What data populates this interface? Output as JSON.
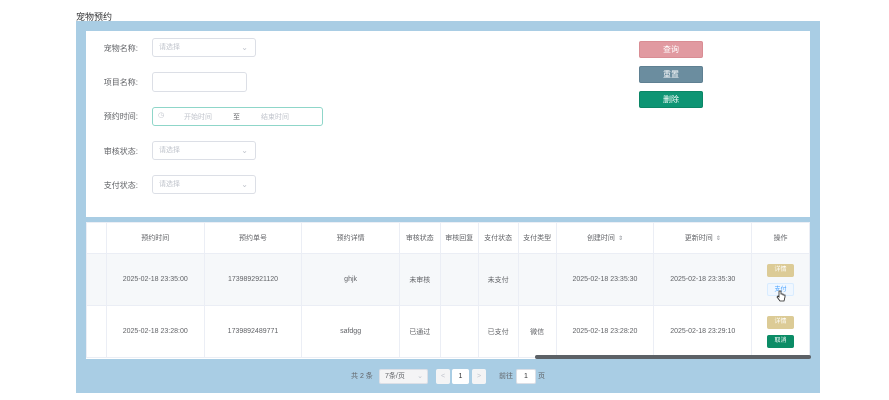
{
  "page": {
    "title": "宠物预约"
  },
  "form": {
    "pet_name_label": "宠物名称:",
    "pet_name_placeholder": "请选择",
    "project_name_label": "项目名称:",
    "project_name_value": "",
    "appointment_time_label": "预约时间:",
    "start_placeholder": "开始时间",
    "range_separator": "至",
    "end_placeholder": "结束时间",
    "review_status_label": "审核状态:",
    "review_status_placeholder": "请选择",
    "pay_status_label": "支付状态:",
    "pay_status_placeholder": "请选择"
  },
  "actions": {
    "query": "查询",
    "reset": "重置",
    "delete": "删除"
  },
  "table": {
    "headers": [
      "预约时间",
      "预约单号",
      "预约详情",
      "审核状态",
      "审核回复",
      "支付状态",
      "支付类型",
      "创建时间",
      "更新时间",
      "操作"
    ],
    "rows": [
      {
        "time": "2025-02-18 23:35:00",
        "order_no": "1739892921120",
        "detail": "ghjk",
        "review_status": "未审核",
        "review_reply": "",
        "pay_status": "未支付",
        "pay_type": "",
        "created": "2025-02-18 23:35:30",
        "updated": "2025-02-18 23:35:30",
        "op_detail": "详情",
        "op_second": "支付"
      },
      {
        "time": "2025-02-18 23:28:00",
        "order_no": "1739892489771",
        "detail": "safdgg",
        "review_status": "已通过",
        "review_reply": "",
        "pay_status": "已支付",
        "pay_type": "微信",
        "created": "2025-02-18 23:28:20",
        "updated": "2025-02-18 23:29:10",
        "op_detail": "详情",
        "op_second": "取消"
      }
    ]
  },
  "pagination": {
    "total": "共 2 条",
    "page_size": "7条/页",
    "prev": "<",
    "current": "1",
    "next": ">",
    "goto_label": "前往",
    "goto_value": "1",
    "page_suffix": "页"
  },
  "colors": {
    "panel_bg": "#a9cde4",
    "query_btn": "#e19aa1",
    "reset_btn": "#6b8d9f",
    "delete_btn": "#0e9574",
    "detail_btn": "#dccb96",
    "cancel_btn": "#0b8c66"
  },
  "icons": {
    "sort": "sort-icon",
    "chevron": "chevron-down-icon",
    "clock": "clock-icon",
    "cursor": "hand-cursor-icon"
  }
}
